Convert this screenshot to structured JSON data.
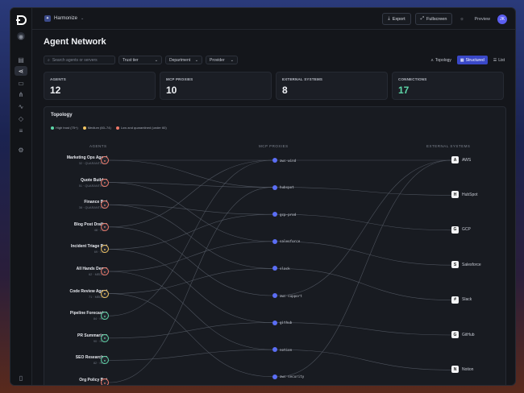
{
  "topbar": {
    "workspace": "Harmonize",
    "export_label": "Export",
    "fullscreen_label": "Fullscreen",
    "preview_label": "Preview",
    "avatar_initials": "JK"
  },
  "page": {
    "title": "Agent Network",
    "search_placeholder": "Search agents or servers",
    "filters": [
      "Trust tier",
      "Department",
      "Provider"
    ],
    "views": [
      {
        "label": "Topology",
        "icon": "topology-icon"
      },
      {
        "label": "Structured",
        "icon": "structured-icon"
      },
      {
        "label": "List",
        "icon": "list-icon"
      }
    ]
  },
  "stats": [
    {
      "label": "AGENTS",
      "value": "12"
    },
    {
      "label": "MCP PROXIES",
      "value": "10"
    },
    {
      "label": "EXTERNAL SYSTEMS",
      "value": "8"
    },
    {
      "label": "CONNECTIONS",
      "value": "17"
    }
  ],
  "topology": {
    "title": "Topology",
    "legend": [
      {
        "label": "High trust (75+)",
        "color": "#5ed6a8"
      },
      {
        "label": "Medium (60–74)",
        "color": "#f2c462"
      },
      {
        "label": "Low and quarantined (under 60)",
        "color": "#f07a6a"
      }
    ],
    "columns": {
      "agents": "AGENTS",
      "proxies": "MCP PROXIES",
      "external": "EXTERNAL SYSTEMS"
    },
    "agents": [
      {
        "name": "Marketing Ops Agent",
        "meta": "32 · QUARANTINED",
        "color": "#f07a6a"
      },
      {
        "name": "Quote Builder",
        "meta": "51 · QUARANTINED",
        "color": "#f07a6a"
      },
      {
        "name": "Finance Bot",
        "meta": "38 · QUARANTINED",
        "color": "#f07a6a"
      },
      {
        "name": "Blog Post Drafter",
        "meta": "48 · LOW",
        "color": "#f07a6a"
      },
      {
        "name": "Incident Triage Bot",
        "meta": "69 · LOW",
        "color": "#f2c462"
      },
      {
        "name": "All Hands Demo",
        "meta": "62 · MEDIUM",
        "color": "#f07a6a"
      },
      {
        "name": "Code Review Agent",
        "meta": "71 · MEDIUM",
        "color": "#f2c462"
      },
      {
        "name": "Pipeline Forecaster",
        "meta": "84 · HIGH",
        "color": "#5ed6a8"
      },
      {
        "name": "PR Summarizer",
        "meta": "90 · HIGH",
        "color": "#5ed6a8"
      },
      {
        "name": "SEO Researcher",
        "meta": "82 · HIGH",
        "color": "#5ed6a8"
      },
      {
        "name": "Org Policy Bot",
        "meta": "",
        "color": "#f07a6a"
      }
    ],
    "proxies": [
      "aws-wind",
      "hubspot",
      "gcp-prod",
      "salesforce",
      "slack",
      "aws-support",
      "github",
      "notion",
      "aws-security"
    ],
    "external": [
      {
        "name": "AWS",
        "badge": "A"
      },
      {
        "name": "HubSpot",
        "badge": "H"
      },
      {
        "name": "GCP",
        "badge": "G"
      },
      {
        "name": "Salesforce",
        "badge": "S"
      },
      {
        "name": "Slack",
        "badge": "#"
      },
      {
        "name": "GitHub",
        "badge": "G"
      },
      {
        "name": "Notion",
        "badge": "N"
      }
    ],
    "agent_proxy_links": [
      [
        0,
        0
      ],
      [
        0,
        1
      ],
      [
        1,
        1
      ],
      [
        1,
        3
      ],
      [
        2,
        2
      ],
      [
        2,
        4
      ],
      [
        3,
        0
      ],
      [
        3,
        5
      ],
      [
        4,
        2
      ],
      [
        4,
        6
      ],
      [
        5,
        3
      ],
      [
        5,
        7
      ],
      [
        6,
        4
      ],
      [
        6,
        8
      ],
      [
        7,
        0
      ],
      [
        8,
        6
      ],
      [
        9,
        7
      ],
      [
        10,
        1
      ]
    ],
    "proxy_ext_links": [
      [
        0,
        0
      ],
      [
        1,
        1
      ],
      [
        2,
        2
      ],
      [
        3,
        3
      ],
      [
        4,
        4
      ],
      [
        5,
        0
      ],
      [
        6,
        5
      ],
      [
        7,
        6
      ],
      [
        8,
        0
      ]
    ]
  }
}
